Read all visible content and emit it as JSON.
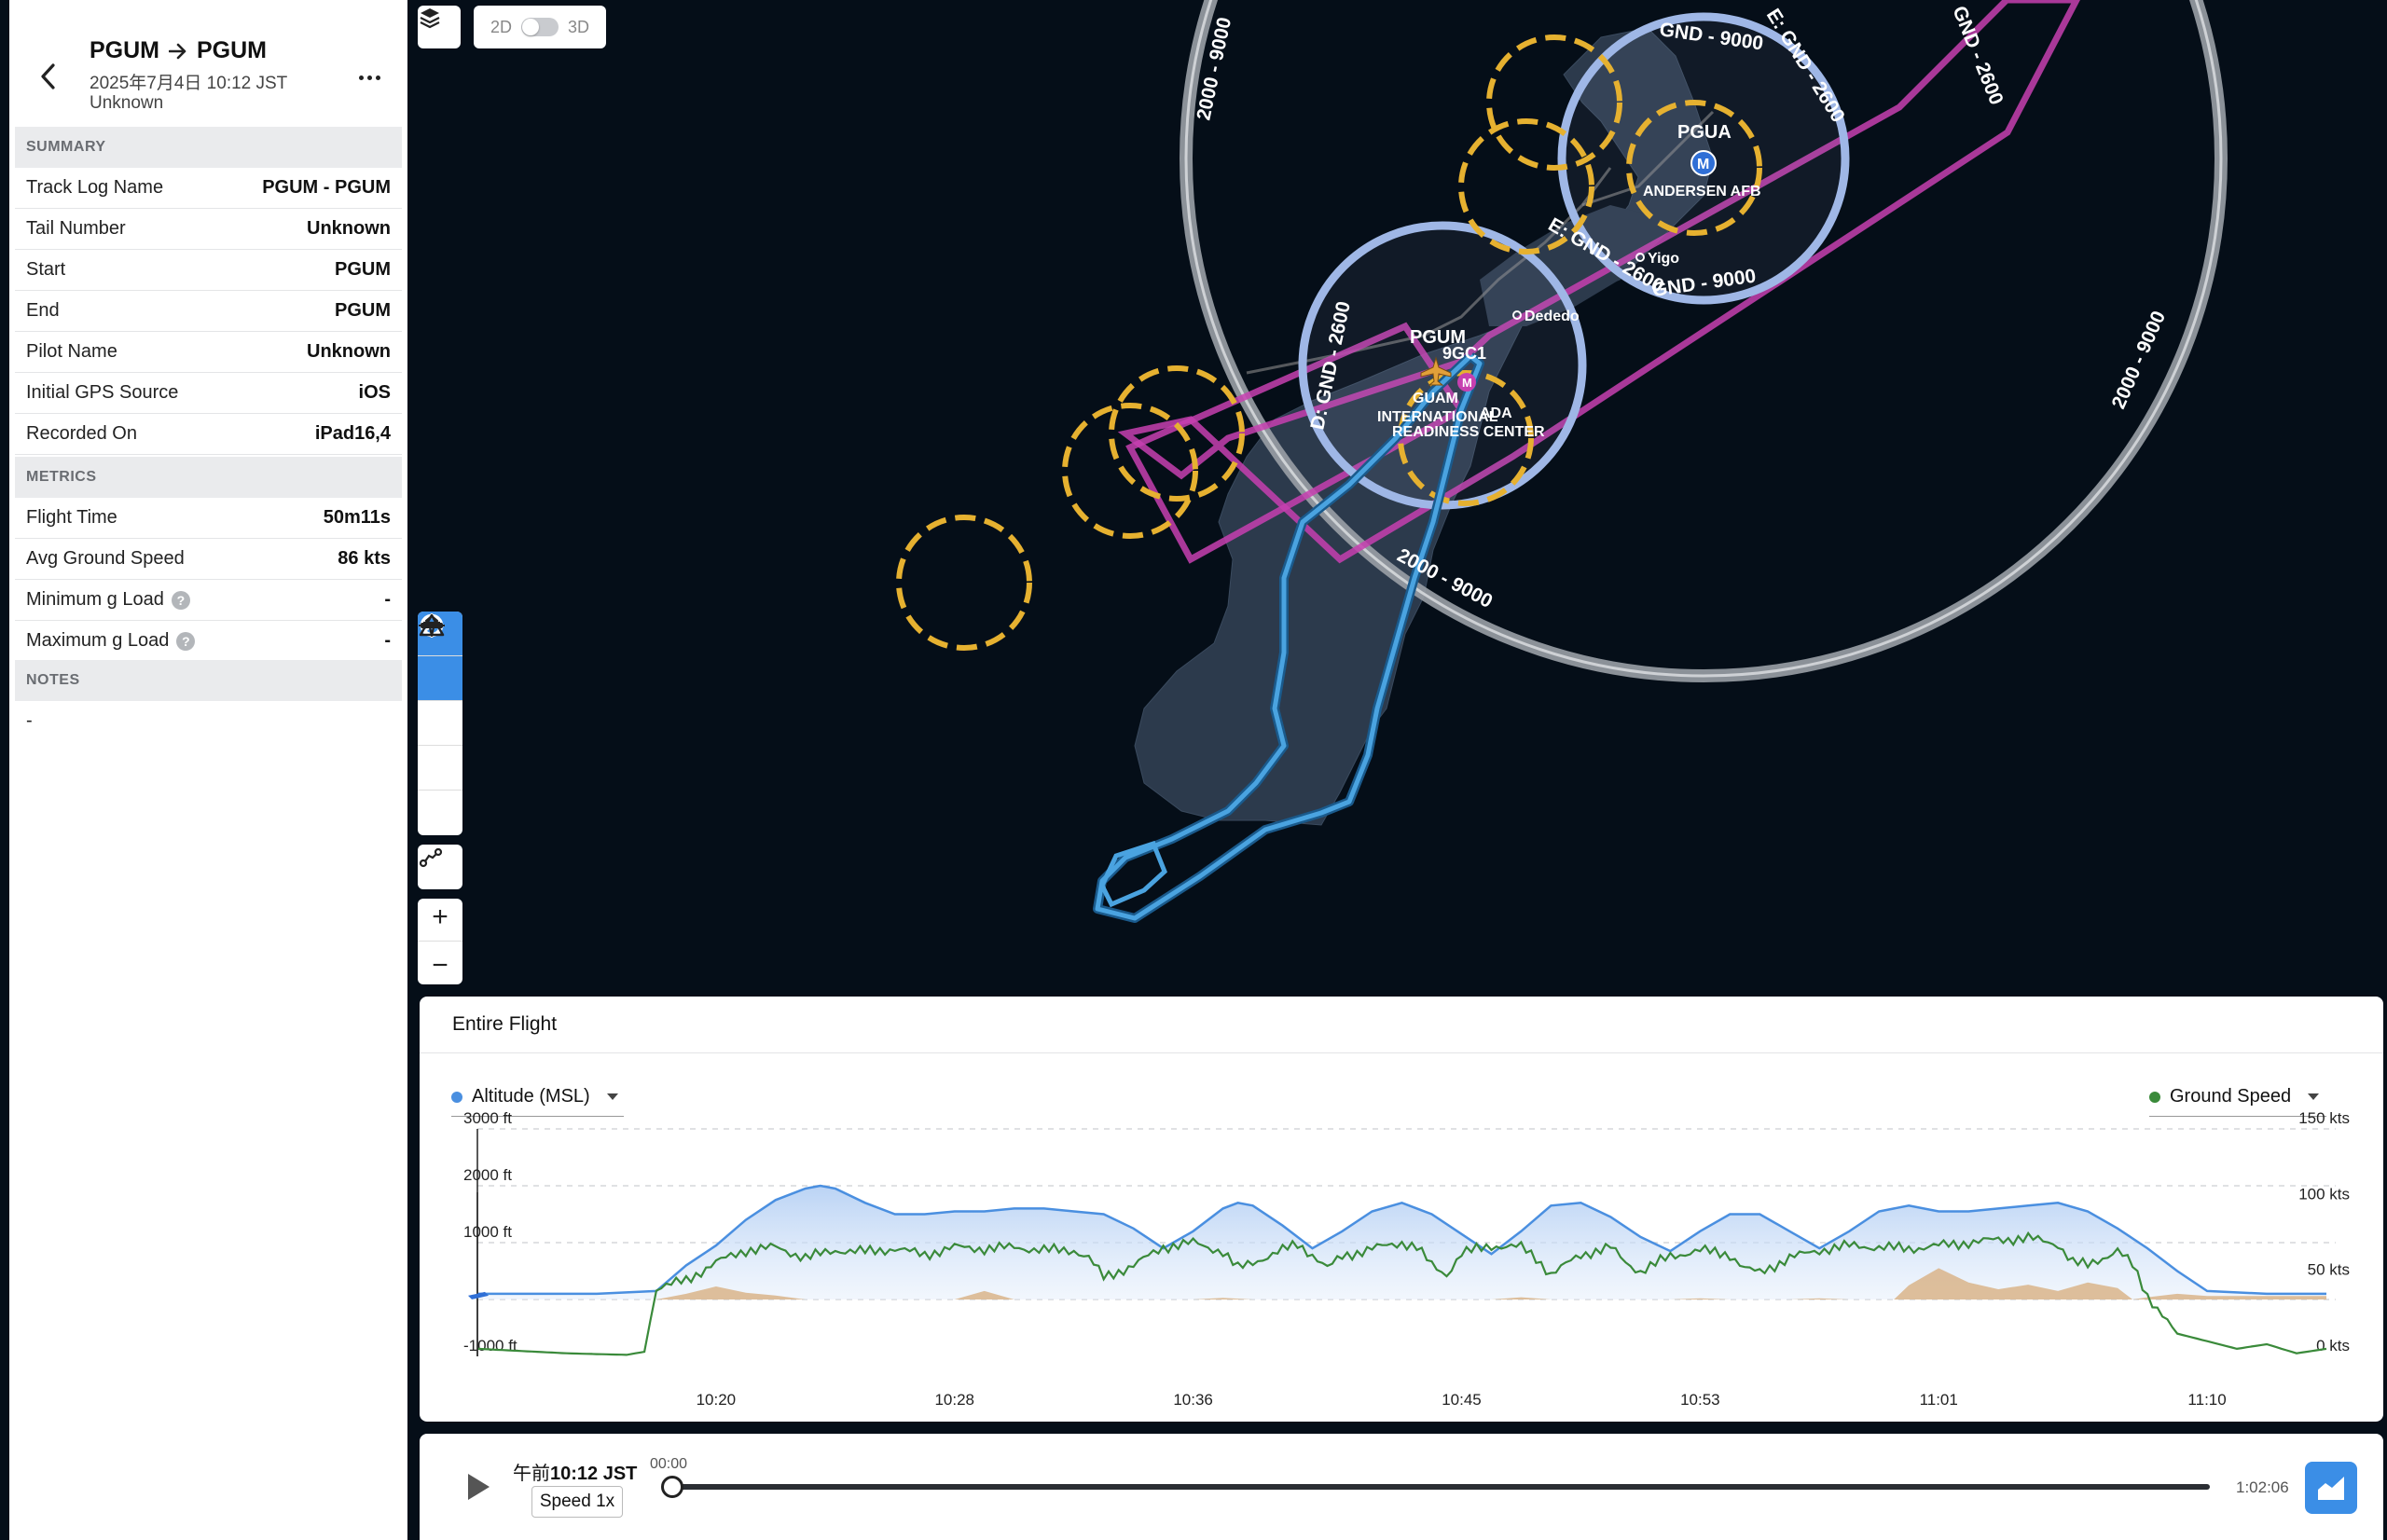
{
  "header": {
    "from": "PGUM",
    "to": "PGUM",
    "date": "2025年7月4日 10:12 JST",
    "pilot": "Unknown"
  },
  "summary": {
    "section_label": "SUMMARY",
    "rows": [
      {
        "label": "Track Log Name",
        "value": "PGUM - PGUM"
      },
      {
        "label": "Tail Number",
        "value": "Unknown"
      },
      {
        "label": "Start",
        "value": "PGUM"
      },
      {
        "label": "End",
        "value": "PGUM"
      },
      {
        "label": "Pilot Name",
        "value": "Unknown"
      },
      {
        "label": "Initial GPS Source",
        "value": "iOS"
      },
      {
        "label": "Recorded On",
        "value": "iPad16,4"
      }
    ]
  },
  "metrics": {
    "section_label": "METRICS",
    "rows": [
      {
        "label": "Flight Time",
        "value": "50m11s"
      },
      {
        "label": "Avg Ground Speed",
        "value": "86 kts"
      },
      {
        "label": "Minimum g Load",
        "value": "-"
      },
      {
        "label": "Maximum g Load",
        "value": "-"
      }
    ]
  },
  "notes": {
    "section_label": "NOTES",
    "text": "-"
  },
  "map": {
    "toggle_2d": "2D",
    "toggle_3d": "3D",
    "zoom_in": "+",
    "zoom_out": "−",
    "labels": {
      "pgua": "PGUA",
      "andersen": "ANDERSEN AFB",
      "yigo": "Yigo",
      "dededo": "Dededo",
      "pgum": "PGUM",
      "code_9gc1": "9GC1",
      "guam": "GUAM",
      "intl": "INTERNATIONAL",
      "ada": "ADA",
      "readiness": "READINESS CENTER",
      "m": "M"
    },
    "airspace": {
      "ring_2000_9000": "2000 - 9000",
      "gnd_9000": "GND - 9000",
      "e_gnd_2600": "E: GND - 2600",
      "gnd_2600": "GND - 2600",
      "d_gnd_2600": "D: GND - 2600"
    },
    "colors": {
      "track": "#4aa3e0",
      "class_b_ring": "#9aa0a6",
      "class_d_ring": "#9fb7e6",
      "class_e": "#c740b0",
      "mil_ring": "#e6b130",
      "island": "#2c3a4c"
    }
  },
  "chart": {
    "title": "Entire Flight",
    "left_series_select": "Altitude (MSL)",
    "right_series_select": "Ground Speed",
    "left_color": "#4a8fe0",
    "right_color": "#3a8a3a",
    "terrain_color": "#d9b48a"
  },
  "chart_data": {
    "type": "line",
    "left_axis": {
      "label": "Altitude (MSL)",
      "unit": "ft",
      "ticks": [
        "3000 ft",
        "2000 ft",
        "1000 ft",
        "-1000 ft"
      ],
      "ylim": [
        -1000,
        3000
      ]
    },
    "right_axis": {
      "label": "Ground Speed",
      "unit": "kts",
      "ticks": [
        "150 kts",
        "100 kts",
        "50 kts",
        "0 kts"
      ],
      "ylim": [
        0,
        150
      ]
    },
    "x_ticks": [
      "10:20",
      "10:28",
      "10:36",
      "10:45",
      "10:53",
      "11:01",
      "11:10"
    ],
    "x_tick_minutes": [
      8,
      16,
      24,
      33,
      41,
      49,
      58
    ],
    "duration_minutes": 62,
    "series": [
      {
        "name": "Altitude (MSL)",
        "color": "#4a8fe0",
        "points": [
          [
            0,
            100
          ],
          [
            4,
            100
          ],
          [
            6,
            150
          ],
          [
            7,
            600
          ],
          [
            8,
            950
          ],
          [
            9,
            1400
          ],
          [
            10,
            1750
          ],
          [
            11,
            1950
          ],
          [
            11.5,
            2000
          ],
          [
            12,
            1950
          ],
          [
            13,
            1700
          ],
          [
            14,
            1500
          ],
          [
            15,
            1500
          ],
          [
            16,
            1550
          ],
          [
            17,
            1550
          ],
          [
            18,
            1600
          ],
          [
            19,
            1600
          ],
          [
            20,
            1550
          ],
          [
            21,
            1500
          ],
          [
            22,
            1250
          ],
          [
            23,
            900
          ],
          [
            24,
            1200
          ],
          [
            25,
            1600
          ],
          [
            25.5,
            1700
          ],
          [
            26,
            1650
          ],
          [
            27,
            1300
          ],
          [
            28,
            900
          ],
          [
            29,
            1200
          ],
          [
            30,
            1550
          ],
          [
            31,
            1700
          ],
          [
            32,
            1500
          ],
          [
            33,
            1150
          ],
          [
            34,
            800
          ],
          [
            35,
            1200
          ],
          [
            36,
            1650
          ],
          [
            37,
            1700
          ],
          [
            38,
            1450
          ],
          [
            39,
            1100
          ],
          [
            40,
            850
          ],
          [
            41,
            1200
          ],
          [
            42,
            1500
          ],
          [
            43,
            1500
          ],
          [
            44,
            1200
          ],
          [
            45,
            900
          ],
          [
            46,
            1200
          ],
          [
            47,
            1550
          ],
          [
            48,
            1650
          ],
          [
            49,
            1550
          ],
          [
            50,
            1550
          ],
          [
            51,
            1600
          ],
          [
            52,
            1650
          ],
          [
            53,
            1700
          ],
          [
            54,
            1550
          ],
          [
            55,
            1250
          ],
          [
            56,
            900
          ],
          [
            57,
            500
          ],
          [
            58,
            150
          ],
          [
            60,
            100
          ],
          [
            62,
            100
          ]
        ]
      },
      {
        "name": "Ground Speed",
        "color": "#3a8a3a",
        "points": [
          [
            0,
            5
          ],
          [
            3,
            2
          ],
          [
            5,
            1
          ],
          [
            5.6,
            3
          ],
          [
            6,
            45
          ],
          [
            7,
            50
          ],
          [
            8,
            62
          ],
          [
            9,
            70
          ],
          [
            10,
            72
          ],
          [
            11,
            65
          ],
          [
            12,
            70
          ],
          [
            13,
            69
          ],
          [
            14,
            71
          ],
          [
            15,
            67
          ],
          [
            16,
            72
          ],
          [
            17,
            71
          ],
          [
            18,
            72
          ],
          [
            19,
            70
          ],
          [
            20,
            70
          ],
          [
            20.5,
            65
          ],
          [
            21,
            52
          ],
          [
            22,
            60
          ],
          [
            23,
            72
          ],
          [
            24,
            75
          ],
          [
            25,
            69
          ],
          [
            25.5,
            58
          ],
          [
            26,
            62
          ],
          [
            27,
            70
          ],
          [
            27.5,
            74
          ],
          [
            28,
            67
          ],
          [
            28.5,
            58
          ],
          [
            29,
            66
          ],
          [
            30,
            71
          ],
          [
            31,
            75
          ],
          [
            31.5,
            72
          ],
          [
            32,
            60
          ],
          [
            32.5,
            54
          ],
          [
            33,
            68
          ],
          [
            34,
            73
          ],
          [
            35,
            72
          ],
          [
            35.5,
            65
          ],
          [
            36,
            54
          ],
          [
            37,
            67
          ],
          [
            38,
            72
          ],
          [
            38.5,
            62
          ],
          [
            39,
            56
          ],
          [
            40,
            66
          ],
          [
            41,
            70
          ],
          [
            42,
            67
          ],
          [
            42.5,
            58
          ],
          [
            43,
            55
          ],
          [
            44,
            65
          ],
          [
            45,
            70
          ],
          [
            46,
            73
          ],
          [
            47,
            72
          ],
          [
            48,
            71
          ],
          [
            49,
            73
          ],
          [
            50,
            75
          ],
          [
            51,
            77
          ],
          [
            52,
            78
          ],
          [
            53,
            74
          ],
          [
            53.5,
            62
          ],
          [
            54,
            60
          ],
          [
            55,
            70
          ],
          [
            55.5,
            60
          ],
          [
            56,
            40
          ],
          [
            57,
            15
          ],
          [
            58,
            10
          ],
          [
            59,
            5
          ],
          [
            60,
            8
          ],
          [
            61,
            2
          ],
          [
            62,
            5
          ]
        ]
      },
      {
        "name": "Terrain",
        "color": "#d9b48a",
        "points": [
          [
            0,
            -10
          ],
          [
            6,
            -10
          ],
          [
            7,
            100
          ],
          [
            8,
            230
          ],
          [
            9,
            120
          ],
          [
            10,
            70
          ],
          [
            11,
            0
          ],
          [
            16,
            0
          ],
          [
            17,
            150
          ],
          [
            18,
            0
          ],
          [
            24,
            0
          ],
          [
            25,
            30
          ],
          [
            26,
            0
          ],
          [
            34,
            0
          ],
          [
            35,
            40
          ],
          [
            36,
            0
          ],
          [
            40,
            0
          ],
          [
            41,
            20
          ],
          [
            42,
            0
          ],
          [
            44,
            0
          ],
          [
            45,
            20
          ],
          [
            46,
            0
          ],
          [
            47.5,
            0
          ],
          [
            48,
            250
          ],
          [
            49,
            550
          ],
          [
            50,
            300
          ],
          [
            51,
            180
          ],
          [
            52,
            260
          ],
          [
            53,
            150
          ],
          [
            54,
            300
          ],
          [
            55,
            200
          ],
          [
            55.5,
            0
          ],
          [
            56,
            40
          ],
          [
            57,
            100
          ],
          [
            58,
            60
          ],
          [
            62,
            60
          ]
        ]
      }
    ]
  },
  "playback": {
    "time_prefix": "午前",
    "time": "10:12 JST",
    "position_label": "00:00",
    "duration_label": "1:02:06",
    "speed_label": "Speed 1x",
    "progress": 0
  }
}
